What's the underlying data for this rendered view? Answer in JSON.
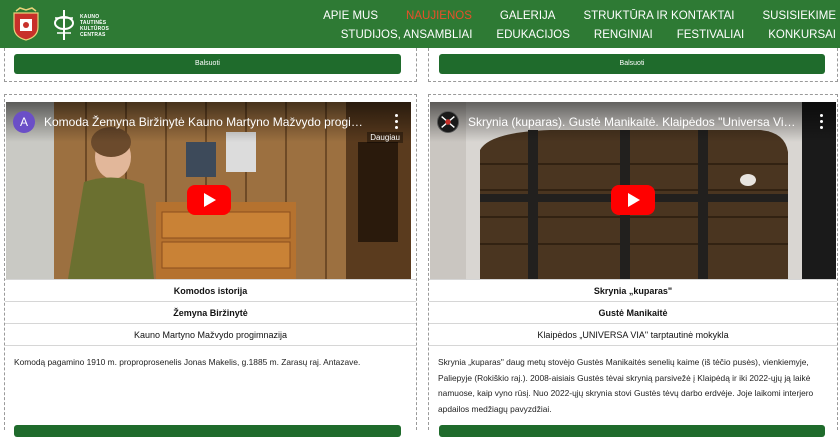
{
  "header": {
    "logo_text": [
      "KAUNO",
      "TAUTINĖS",
      "KULTŪROS",
      "CENTRAS"
    ],
    "brand_color": "#2e7a34",
    "active_color": "#e8502a",
    "nav_row1": [
      "APIE MUS",
      "NAUJIENOS",
      "GALERIJA",
      "STRUKTŪRA IR KONTAKTAI",
      "SUSISIEKIME"
    ],
    "nav_row2": [
      "STUDIJOS, ANSAMBLIAI",
      "EDUKACIJOS",
      "RENGINIAI",
      "FESTIVALIAI",
      "KONKURSAI"
    ],
    "active_item": "NAUJIENOS"
  },
  "vote_label": "Balsuoti",
  "cards": [
    {
      "video_title": "Komoda Žemyna Biržinytė Kauno Martyno Mažvydo progimnazija",
      "channel_initial": "A",
      "more_label": "Daugiau",
      "title": "Komodos istorija",
      "author": "Žemyna Biržinytė",
      "school": "Kauno Martyno Mažvydo progimnazija",
      "description": "Komodą pagamino 1910 m. proproprosenelis Jonas Makelis, g.1885 m. Zarasų raj. Antazave."
    },
    {
      "video_title": "Skrynia (kuparas). Gustė Manikaitė. Klaipėdos \"Universa Via\" tar...",
      "title": "Skrynia „kuparas\"",
      "author": "Gustė Manikaitė",
      "school": "Klaipėdos „UNIVERSA VIA\" tarptautinė mokykla",
      "description": "Skrynia „kuparas\" daug metų stovėjo Gustės Manikaitės senelių kaime (iš tėčio pusės), vienkiemyje, Paliepyje (Rokiškio raj.). 2008-aisiais Gustės tėvai skrynią parsivežė į Klaipėdą ir iki 2022-ųjų ją laikė namuose, kaip vyno rūsį. Nuo 2022-ųjų skrynia stovi Gustės tėvų darbo erdvėje. Joje laikomi interjero apdailos medžiagų pavyzdžiai."
    }
  ]
}
